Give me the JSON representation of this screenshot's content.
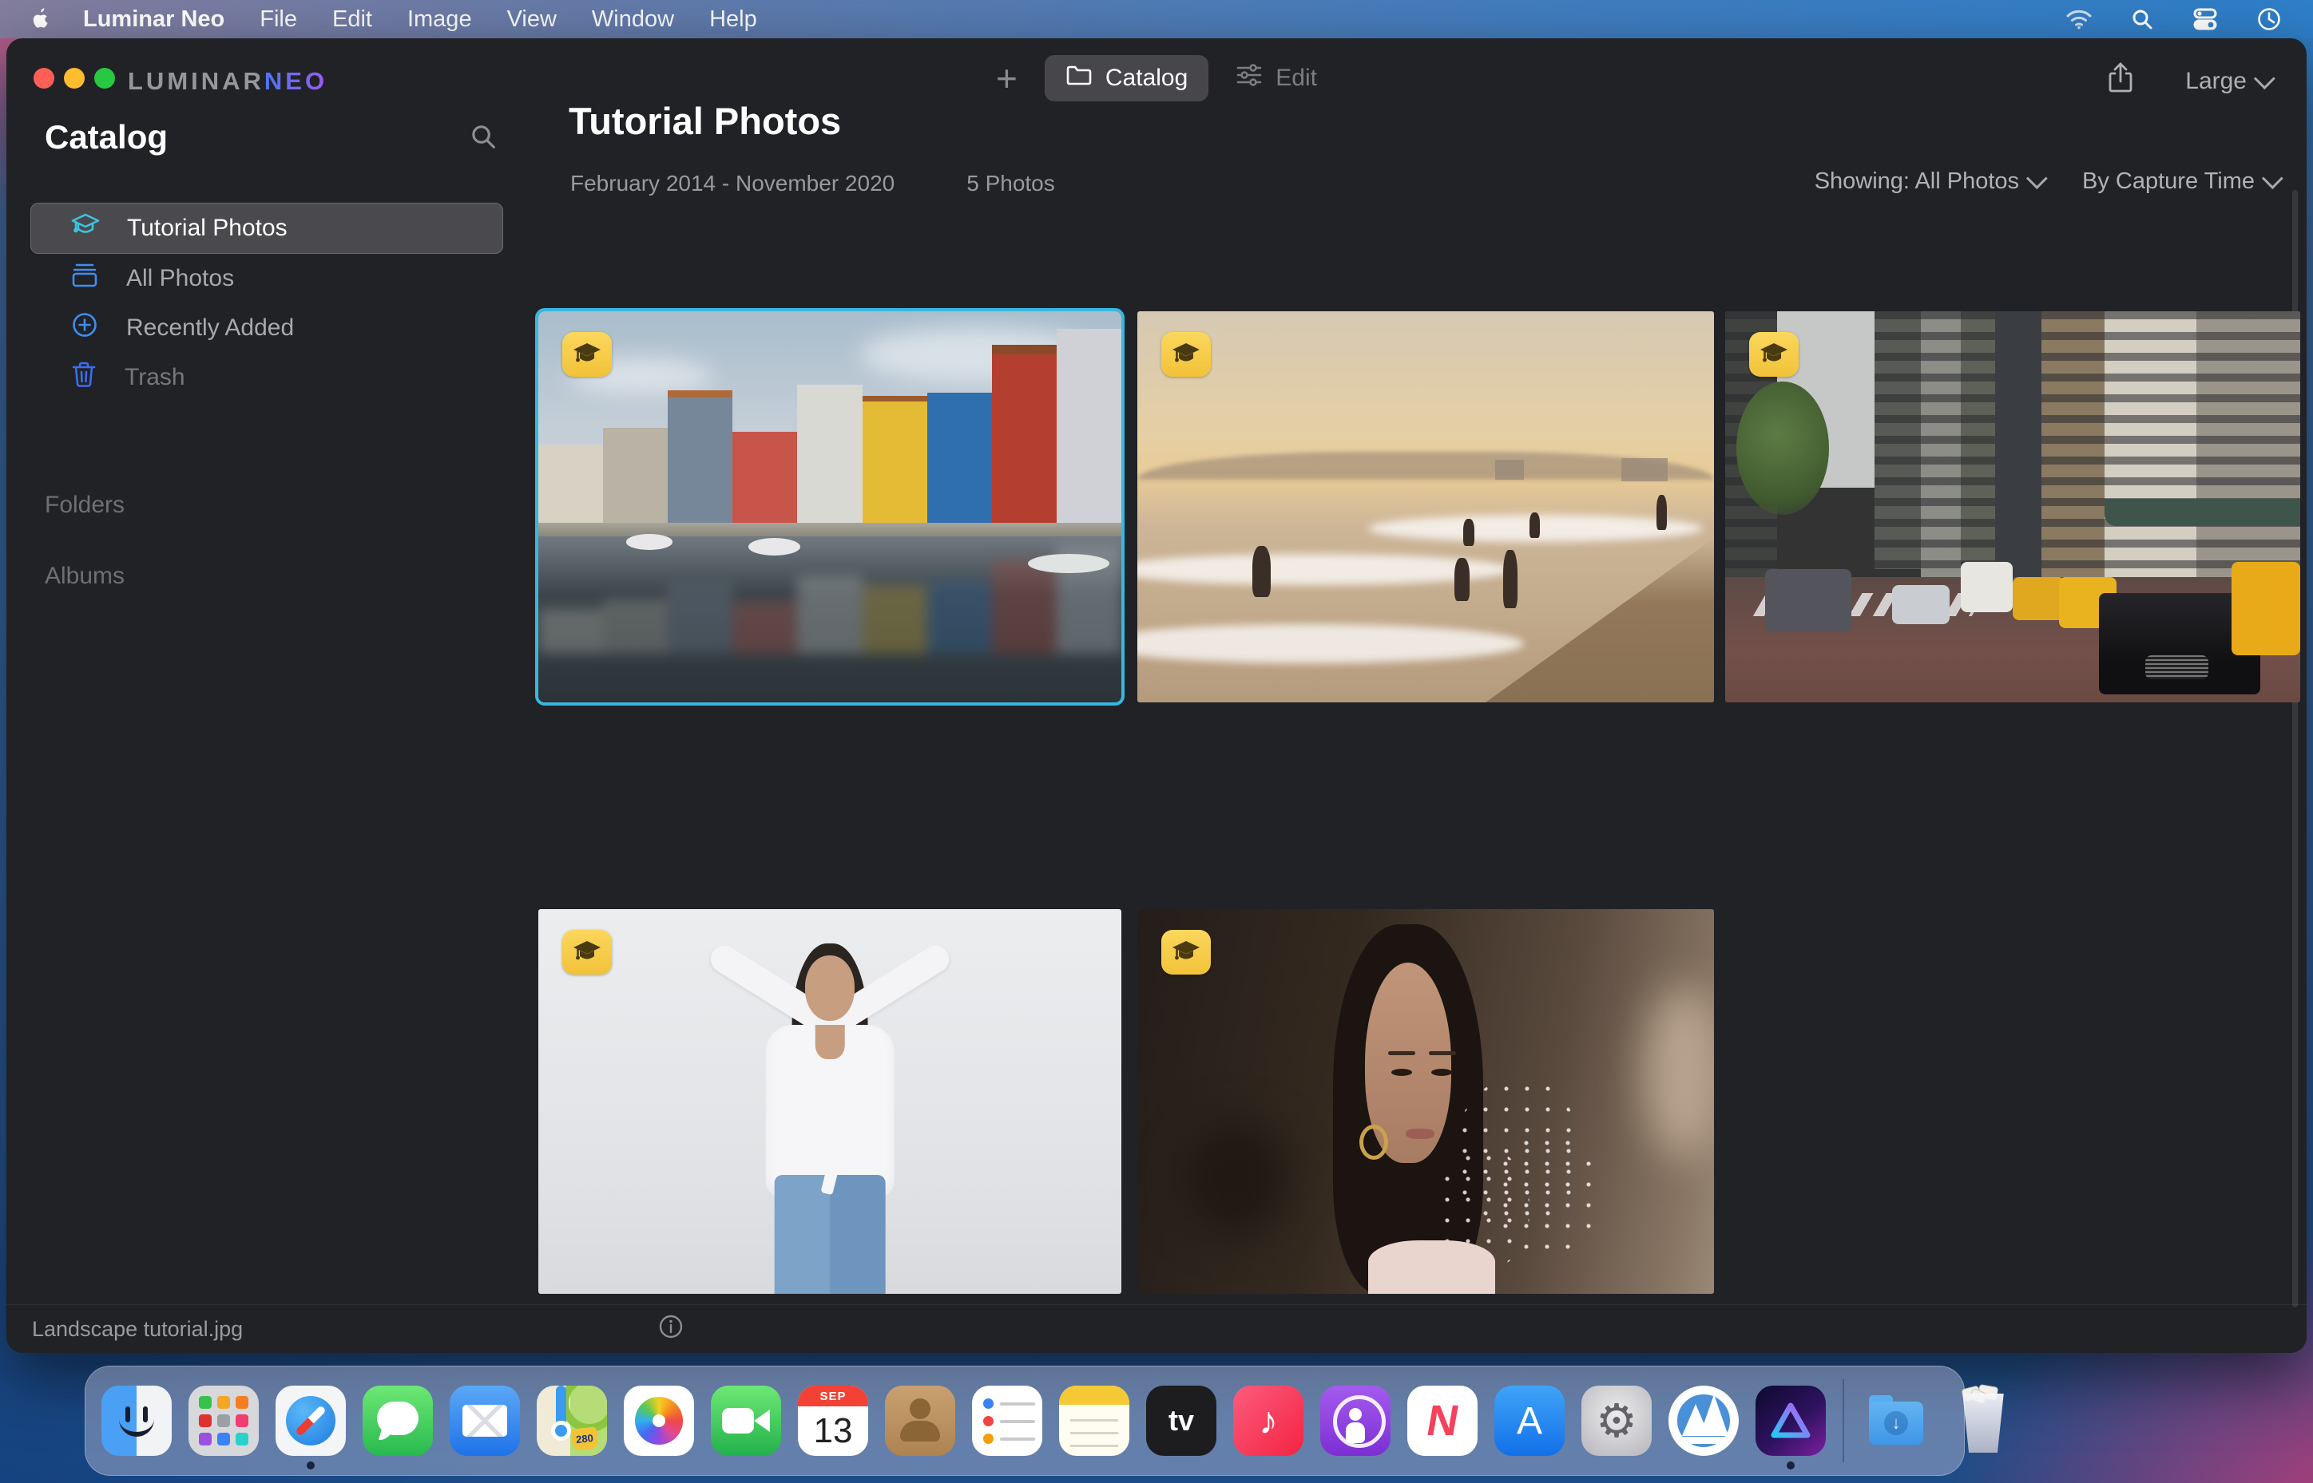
{
  "menu_bar": {
    "app_name": "Luminar Neo",
    "items": [
      "File",
      "Edit",
      "Image",
      "View",
      "Window",
      "Help"
    ],
    "status_icons": [
      "wifi-icon",
      "search-icon",
      "control-center-icon",
      "clock-icon"
    ]
  },
  "titlebar": {
    "logo_primary": "LUMINAR",
    "logo_accent": "NEO",
    "add_button": "+",
    "catalog_tab": "Catalog",
    "edit_tab": "Edit",
    "size_selector": "Large"
  },
  "sidebar": {
    "title": "Catalog",
    "items": [
      {
        "label": "Tutorial Photos",
        "icon": "graduation-cap-icon",
        "selected": true
      },
      {
        "label": "All Photos",
        "icon": "photo-stack-icon",
        "selected": false
      },
      {
        "label": "Recently Added",
        "icon": "plus-circle-icon",
        "selected": false
      },
      {
        "label": "Trash",
        "icon": "trash-icon",
        "selected": false
      }
    ],
    "sections": [
      {
        "label": "Folders"
      },
      {
        "label": "Albums"
      }
    ]
  },
  "content": {
    "title": "Tutorial Photos",
    "date_range": "February 2014 - November 2020",
    "photo_count": "5 Photos",
    "showing_filter": "Showing: All Photos",
    "sort_filter": "By Capture Time",
    "photos": [
      {
        "desc": "Colorful canal houses reflected in still water",
        "selected": true
      },
      {
        "desc": "People on a beach at golden sunset",
        "selected": false
      },
      {
        "desc": "New York city street with yellow taxis",
        "selected": false
      },
      {
        "desc": "Woman in white tie-front top and jeans on studio background",
        "selected": false
      },
      {
        "desc": "Portrait of woman with pink tulle flower accessory",
        "selected": false
      }
    ]
  },
  "status_bar": {
    "filename": "Landscape tutorial.jpg"
  },
  "dock": {
    "apps": [
      "Finder",
      "Launchpad",
      "Safari",
      "Messages",
      "Mail",
      "Maps",
      "Photos",
      "FaceTime",
      "Calendar",
      "Contacts",
      "Reminders",
      "Notes",
      "TV",
      "Music",
      "Podcasts",
      "News",
      "App Store",
      "System Settings",
      "Luminar",
      "Luminar Neo",
      "Downloads",
      "Trash"
    ],
    "running_apps": [
      "Finder",
      "Safari",
      "Luminar Neo"
    ],
    "calendar_month": "SEP",
    "calendar_day": "13",
    "maps_shield": "280",
    "tv_glyph": "tv",
    "music_glyph": "♪",
    "news_glyph": "N",
    "appstore_glyph": "A",
    "settings_glyph": "⚙",
    "download_arrow": "↓"
  },
  "colors": {
    "selection_accent": "#35b8e2",
    "badge_yellow": "#f7cb47",
    "sidebar_icon_cyan": "#3cc3e0",
    "sidebar_icon_blue": "#3e8ef0",
    "logo_gradient_start": "#4f74f0",
    "logo_gradient_end": "#9a5cf5"
  }
}
